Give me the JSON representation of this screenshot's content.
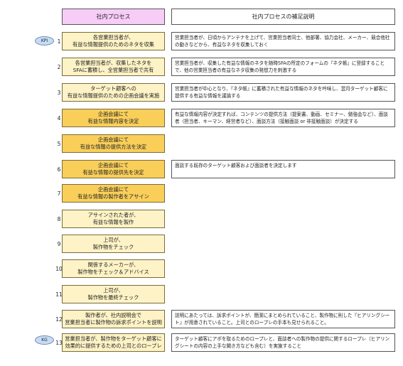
{
  "header": {
    "left": "社内プロセス",
    "right": "社内プロセスの補足説明"
  },
  "badges": {
    "kpi": "KPI",
    "kg": "KG"
  },
  "steps": [
    {
      "num": "1",
      "text": "各営業担当者が、\n有益な情報提供のためのネタを収集",
      "style": "light",
      "note": "営業担当者が、日頃からアンテナを上げて、営業担当者同士、他部署、協力会社、メーカー、競合他社の動きなどから、有益なネタを収集しておく"
    },
    {
      "num": "2",
      "text": "各営業担当者が、収集したネタを\nSFAに蓄積し、全営業担当者で共有",
      "style": "light",
      "note": "営業担当者が、収集した有益な情報のネタを随時SFAの所定のフォームの『ネタ帳』に登録することで、他の営業担当者の有益なネタ収集の発想力を刺激する"
    },
    {
      "num": "3",
      "text": "ターゲット顧客への\n有益な情報提供のための企画会議を実施",
      "style": "light",
      "note": "営業担当者が中心となり、『ネタ帳』に蓄積された有益な情報のネタを吟味し、翌月ターゲット顧客に提供する有益な情報を議論する"
    },
    {
      "num": "4",
      "text": "企画会議にて\n有益な情報内容を決定",
      "style": "dark",
      "note": "有益な情報内容が決定すれば、コンテンツの提供方法（提案書、動画、セミナー、勉強会など）、面談者（担当者、キーマン、経営者など）、面談方法（接触面談 or 非接触面談）が決定する"
    },
    {
      "num": "5",
      "text": "企画会議にて\n有益な情報の提供方法を決定",
      "style": "dark",
      "note": ""
    },
    {
      "num": "6",
      "text": "企画会議にて\n有益な情報の提供先を決定",
      "style": "dark",
      "note": "面談する既存のターゲット顧客および面談者を決定します"
    },
    {
      "num": "7",
      "text": "企画会議にて\n有益な情報の製作者をアサイン",
      "style": "dark",
      "note": ""
    },
    {
      "num": "8",
      "text": "アサインされた者が、\n有益な情報を製作",
      "style": "light",
      "note": ""
    },
    {
      "num": "9",
      "text": "上司が、\n製作物をチェック",
      "style": "light",
      "note": ""
    },
    {
      "num": "10",
      "text": "関係するメーカーが、\n製作物をチェック＆アドバイス",
      "style": "light",
      "note": ""
    },
    {
      "num": "11",
      "text": "上司が、\n製作物を最終チェック",
      "style": "light",
      "note": ""
    },
    {
      "num": "12",
      "text": "製作者が、社内説明会で\n営業担当者に製作物の訴求ポイントを説明",
      "style": "light",
      "note": "説明にあたっては、訴求ポイントが、簡潔にまとめられていること、製作物に則した『ヒアリングシート』が用意されていること。上司とのロープレの手本も見せられること。"
    },
    {
      "num": "13",
      "text": "営業担当者が、製作物をターゲット顧客に\n効果的に提供するための上司とのロープレ",
      "style": "light",
      "note": "ターゲット顧客にアポを取るためのロープレと、面談者への製作物の提供に関するロープレ（ヒアリングシートの内容の上手な聞き方なども含む）を実施すること"
    }
  ]
}
